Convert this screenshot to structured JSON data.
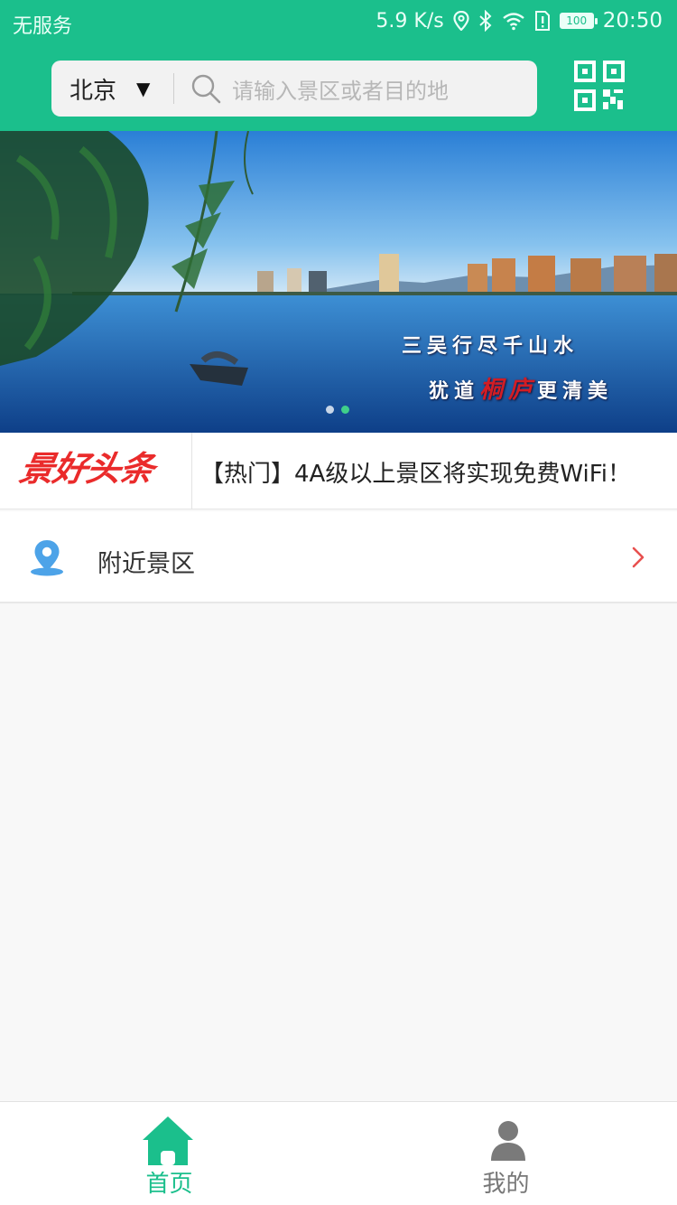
{
  "status_bar": {
    "carrier": "无服务",
    "network_speed": "5.9 K/s",
    "battery": "100",
    "time": "20:50"
  },
  "header": {
    "city": "北京",
    "search_placeholder": "请输入景区或者目的地",
    "scan_icon": "qr-code-icon",
    "background_color": "#1bbf8c"
  },
  "banner": {
    "caption_line1": "三吴行尽千山水",
    "caption_line2_pre": "犹道",
    "caption_line2_accent": "桐庐",
    "caption_line2_post": "更清美",
    "slides": 2,
    "active_slide": 2
  },
  "headline": {
    "logo_text": "景好头条",
    "news_text": "【热门】4A级以上景区将实现免费WiFi！",
    "logo_color": "#ea2b2b"
  },
  "nearby": {
    "label": "附近景区",
    "icon": "location-pin-icon",
    "chevron_color": "#e8504f"
  },
  "tabbar": {
    "home_label": "首页",
    "mine_label": "我的",
    "active_color": "#1bbf8c",
    "inactive_color": "#777777"
  }
}
